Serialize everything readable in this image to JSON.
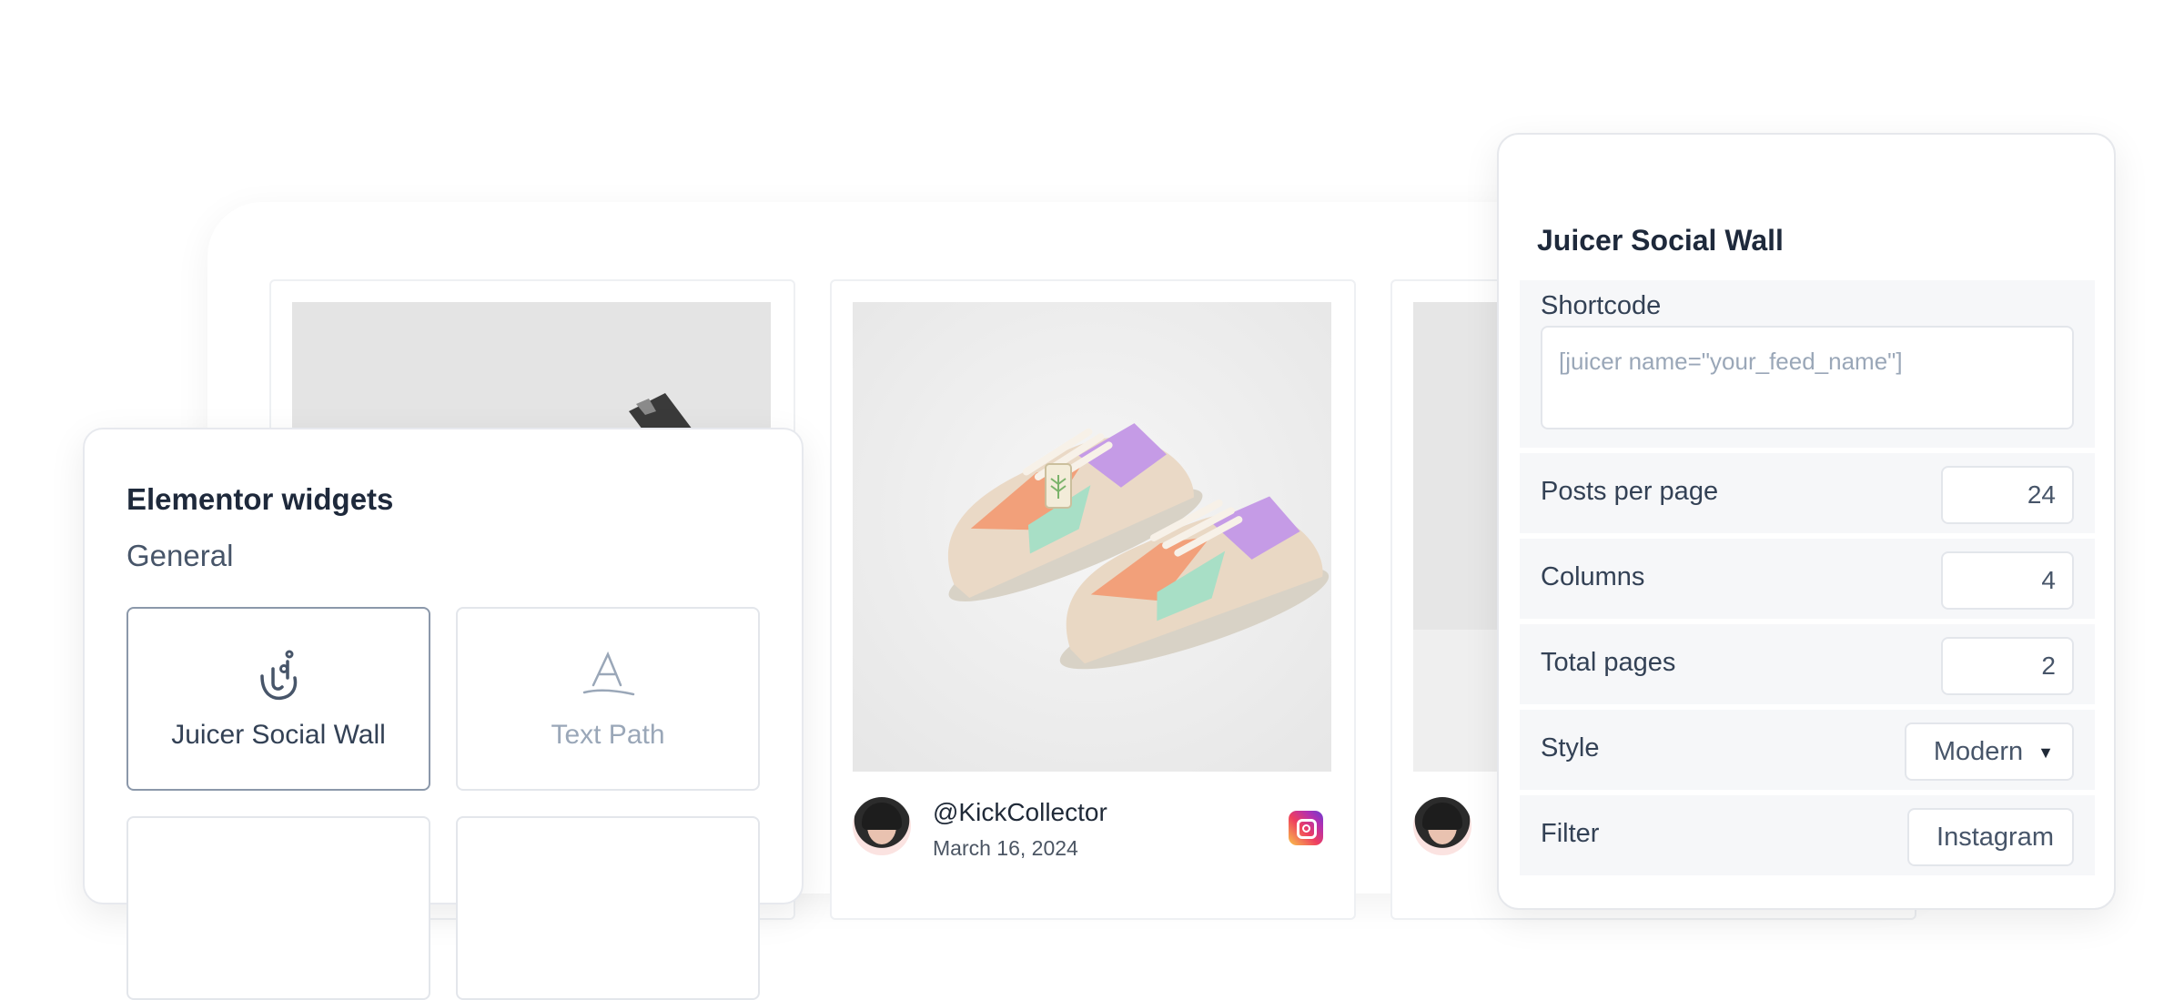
{
  "wall": {
    "cards": [
      {
        "handle": "",
        "date": ""
      },
      {
        "handle": "@KickCollector",
        "date": "March 16, 2024",
        "network_icon": "instagram-icon"
      },
      {
        "handle": "",
        "date": ""
      }
    ]
  },
  "elementor": {
    "title": "Elementor widgets",
    "section": "General",
    "widgets": [
      {
        "label": "Juicer Social Wall",
        "icon": "juicer-icon"
      },
      {
        "label": "Text Path",
        "icon": "text-path-icon"
      }
    ]
  },
  "settings": {
    "title": "Juicer Social Wall",
    "shortcode": {
      "label": "Shortcode",
      "placeholder": "[juicer name=\"your_feed_name\"]"
    },
    "posts_per_page": {
      "label": "Posts per page",
      "value": "24"
    },
    "columns": {
      "label": "Columns",
      "value": "4"
    },
    "total_pages": {
      "label": "Total pages",
      "value": "2"
    },
    "style": {
      "label": "Style",
      "value": "Modern"
    },
    "filter": {
      "label": "Filter",
      "value": "Instagram"
    }
  },
  "colors": {
    "accent": "#8b98aa",
    "instagram": "#ee3e5f"
  }
}
